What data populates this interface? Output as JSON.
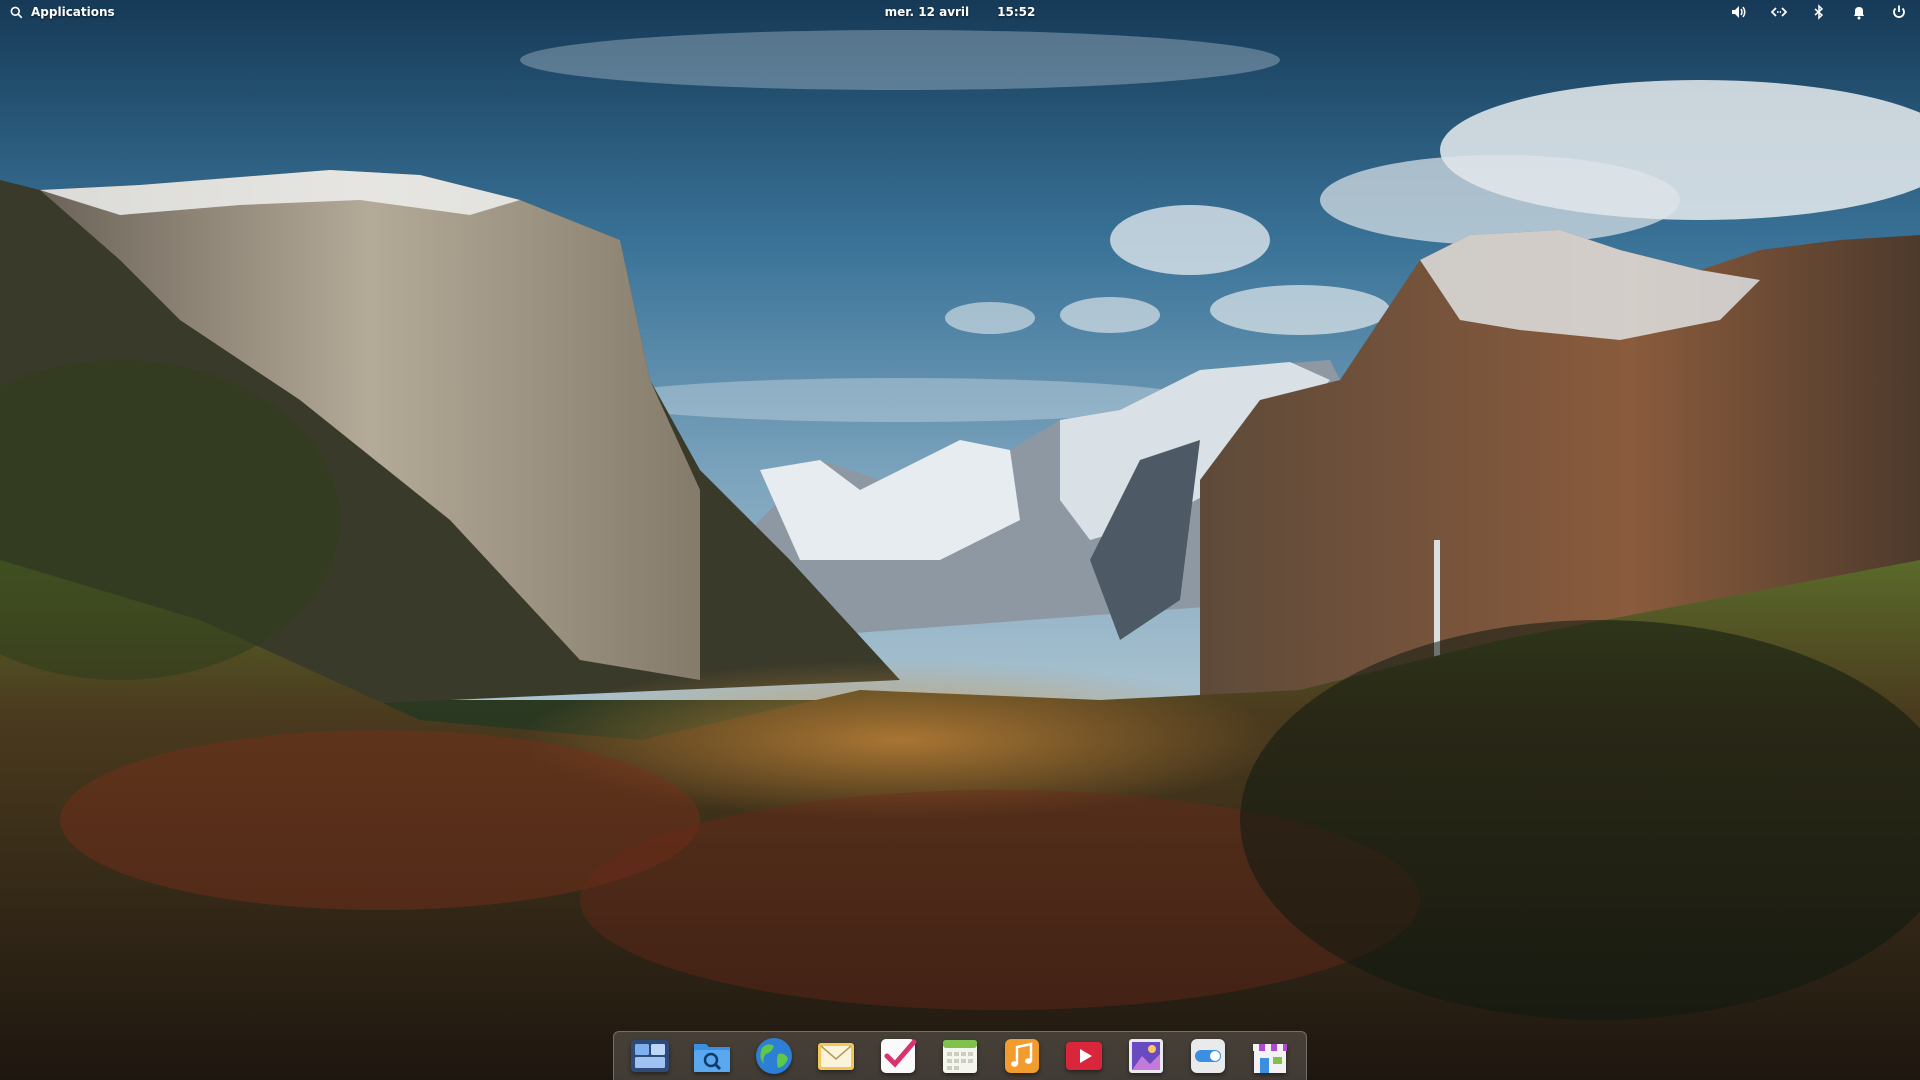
{
  "panel": {
    "applications_label": "Applications",
    "date": "mer. 12 avril",
    "time": "15:52",
    "indicators": [
      {
        "name": "volume-icon"
      },
      {
        "name": "network-icon"
      },
      {
        "name": "bluetooth-icon"
      },
      {
        "name": "notifications-icon"
      },
      {
        "name": "power-icon"
      }
    ]
  },
  "dock": {
    "items": [
      {
        "name": "multitasking-view",
        "icon": "windows-grid-icon"
      },
      {
        "name": "files",
        "icon": "file-manager-icon"
      },
      {
        "name": "web-browser",
        "icon": "globe-icon"
      },
      {
        "name": "mail",
        "icon": "envelope-icon"
      },
      {
        "name": "tasks",
        "icon": "checkmark-icon"
      },
      {
        "name": "calendar",
        "icon": "calendar-icon"
      },
      {
        "name": "music",
        "icon": "music-note-icon"
      },
      {
        "name": "videos",
        "icon": "play-icon"
      },
      {
        "name": "photos",
        "icon": "photos-icon"
      },
      {
        "name": "system-settings",
        "icon": "toggle-icon"
      },
      {
        "name": "app-center",
        "icon": "store-icon"
      }
    ]
  },
  "colors": {
    "panel_text": "#ffffff",
    "dock_background": "rgba(230,230,230,0.18)"
  }
}
